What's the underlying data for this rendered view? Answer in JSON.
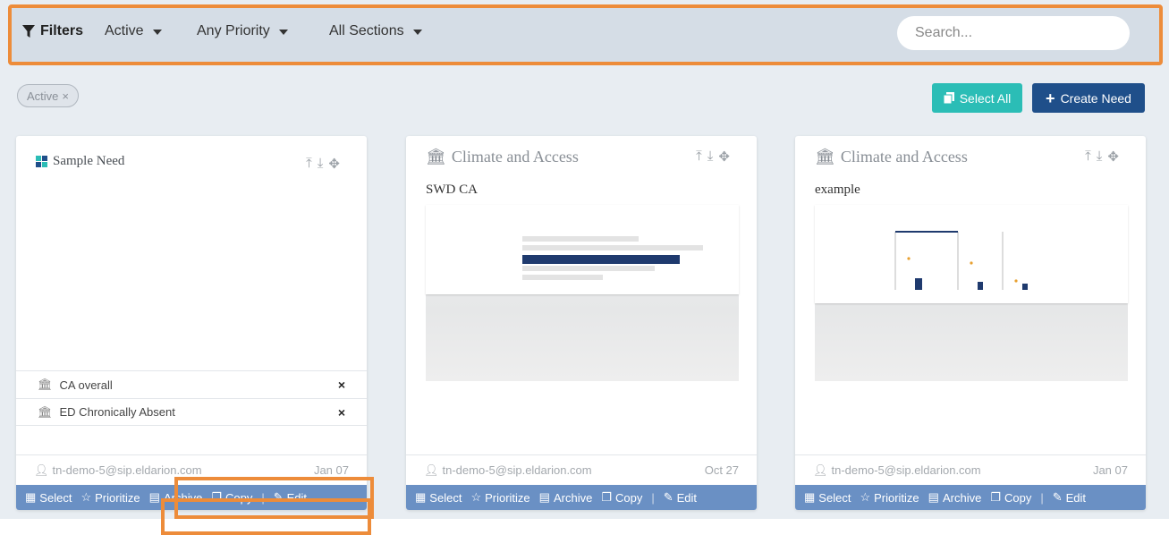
{
  "filterbar": {
    "filters_label": "Filters",
    "status": "Active",
    "priority": "Any Priority",
    "section": "All Sections",
    "search_placeholder": "Search..."
  },
  "chip": {
    "label": "Active",
    "remove": "×"
  },
  "toolbar": {
    "select_all": "Select All",
    "create_need": "Create Need"
  },
  "cards": [
    {
      "title": "Sample Need",
      "tags": [
        {
          "label": "CA overall",
          "remove": "×"
        },
        {
          "label": "ED Chronically Absent",
          "remove": "×"
        }
      ],
      "author": "tn-demo-5@sip.eldarion.com",
      "date": "Jan 07"
    },
    {
      "title": "Climate and Access",
      "subtitle": "SWD CA",
      "author": "tn-demo-5@sip.eldarion.com",
      "date": "Oct 27"
    },
    {
      "title": "Climate and Access",
      "subtitle": "example",
      "author": "tn-demo-5@sip.eldarion.com",
      "date": "Jan 07"
    }
  ],
  "actions": {
    "select": "Select",
    "prioritize": "Prioritize",
    "archive": "Archive",
    "copy": "Copy",
    "edit": "Edit"
  },
  "colors": {
    "accent_orange": "#ed8c3a",
    "teal": "#2bbdb6",
    "navy": "#1f4f8a",
    "action_bar": "#6a90c4"
  }
}
